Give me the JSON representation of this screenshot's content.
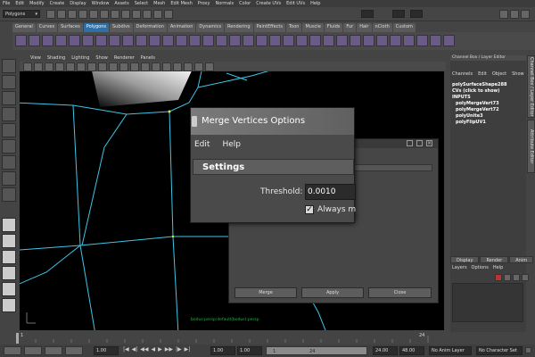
{
  "menubar": [
    "File",
    "Edit",
    "Modify",
    "Create",
    "Display",
    "Window",
    "Assets",
    "Select",
    "Mesh",
    "Edit Mesh",
    "Proxy",
    "Normals",
    "Color",
    "Create UVs",
    "Edit UVs",
    "Help"
  ],
  "status": {
    "mode": "Polygons"
  },
  "shelf_tabs": [
    "General",
    "Curves",
    "Surfaces",
    "Polygons",
    "Subdivs",
    "Deformation",
    "Animation",
    "Dynamics",
    "Rendering",
    "PaintEffects",
    "Toon",
    "Muscle",
    "Fluids",
    "Fur",
    "Hair",
    "nCloth",
    "Custom"
  ],
  "shelf_active": "Polygons",
  "viewport_menu": [
    "View",
    "Shading",
    "Lighting",
    "Show",
    "Renderer",
    "Panels"
  ],
  "viewport_hud": "bodus:persp:default(bodus):persp",
  "channel_box": {
    "title": "Channel Box / Layer Editor",
    "menu": [
      "Channels",
      "Edit",
      "Object",
      "Show"
    ],
    "node": "polySurfaceShape288",
    "cvs": "CVs (click to show)",
    "inputs_label": "INPUTS",
    "inputs": [
      "polyMergeVert73",
      "polyMergeVert72",
      "polyUnite3",
      "polyFlipUV1"
    ],
    "side_tab1": "Channel Box / Layer Editor",
    "side_tab2": "Attribute Editor"
  },
  "layer_editor": {
    "tabs": [
      "Display",
      "Render",
      "Anim"
    ],
    "menu": [
      "Layers",
      "Options",
      "Help"
    ]
  },
  "dialog_back": {
    "buttons": [
      "Merge",
      "Apply",
      "Close"
    ]
  },
  "dialog": {
    "title": "Merge Vertices Options",
    "menu": [
      "Edit",
      "Help"
    ],
    "section": "Settings",
    "threshold_label": "Threshold:",
    "threshold_value": "0.0010",
    "always_label": "Always m",
    "always_checked": true
  },
  "timeslider": {
    "tick_1": "1",
    "tick_24": "24"
  },
  "range": {
    "start": "1.00",
    "playback_start": "1.00",
    "current": "1.00",
    "range_label": "1",
    "range_end_label": "24",
    "end": "24.00",
    "playback_end": "48.00",
    "anim_layer": "No Anim Layer",
    "char_set": "No Character Set"
  },
  "colors": {
    "accent": "#2f6fa8",
    "wire": "#3ec6e6",
    "selected_vertex": "#d4e84a"
  }
}
